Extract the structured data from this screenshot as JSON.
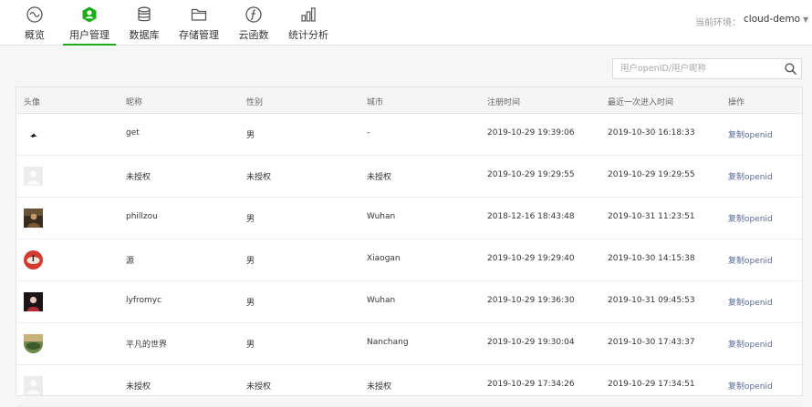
{
  "nav": {
    "items": [
      {
        "label": "概览",
        "icon": "overview-icon"
      },
      {
        "label": "用户管理",
        "icon": "user-management-icon"
      },
      {
        "label": "数据库",
        "icon": "database-icon"
      },
      {
        "label": "存储管理",
        "icon": "storage-folder-icon"
      },
      {
        "label": "云函数",
        "icon": "cloud-function-icon"
      },
      {
        "label": "统计分析",
        "icon": "statistics-chart-icon"
      }
    ],
    "active_index": 1
  },
  "environment": {
    "label": "当前环境：",
    "value": "cloud-demo"
  },
  "search": {
    "placeholder": "用户openID/用户昵称",
    "value": ""
  },
  "table": {
    "headers": [
      "头像",
      "昵称",
      "性别",
      "城市",
      "注册时间",
      "最近一次进入时间",
      "操作"
    ],
    "rows": [
      {
        "nickname": "get",
        "gender": "男",
        "city": "-",
        "registered": "2019-10-29 19:39:06",
        "last_visit": "2019-10-30 16:18:33",
        "action": "复制openid",
        "avatar": "avatar-small-bird"
      },
      {
        "nickname": "未授权",
        "gender": "未授权",
        "city": "未授权",
        "registered": "2019-10-29 19:29:55",
        "last_visit": "2019-10-29 19:29:55",
        "action": "复制openid",
        "avatar": "avatar-placeholder"
      },
      {
        "nickname": "phillzou",
        "gender": "男",
        "city": "Wuhan",
        "registered": "2018-12-16 18:43:48",
        "last_visit": "2019-10-31 11:23:51",
        "action": "复制openid",
        "avatar": "avatar-photo-dark"
      },
      {
        "nickname": "源",
        "gender": "男",
        "city": "Xiaogan",
        "registered": "2019-10-29 19:29:40",
        "last_visit": "2019-10-30 14:15:38",
        "action": "复制openid",
        "avatar": "avatar-photo-red"
      },
      {
        "nickname": "lyfromyc",
        "gender": "男",
        "city": "Wuhan",
        "registered": "2019-10-29 19:36:30",
        "last_visit": "2019-10-31 09:45:53",
        "action": "复制openid",
        "avatar": "avatar-photo-person"
      },
      {
        "nickname": "平凡的世界",
        "gender": "男",
        "city": "Nanchang",
        "registered": "2019-10-29 19:30:04",
        "last_visit": "2019-10-30 17:43:37",
        "action": "复制openid",
        "avatar": "avatar-photo-landscape"
      },
      {
        "nickname": "未授权",
        "gender": "未授权",
        "city": "未授权",
        "registered": "2019-10-29 17:34:26",
        "last_visit": "2019-10-29 17:34:51",
        "action": "复制openid",
        "avatar": "avatar-placeholder"
      }
    ]
  },
  "colors": {
    "accent": "#1aad19",
    "link": "#576b95"
  }
}
